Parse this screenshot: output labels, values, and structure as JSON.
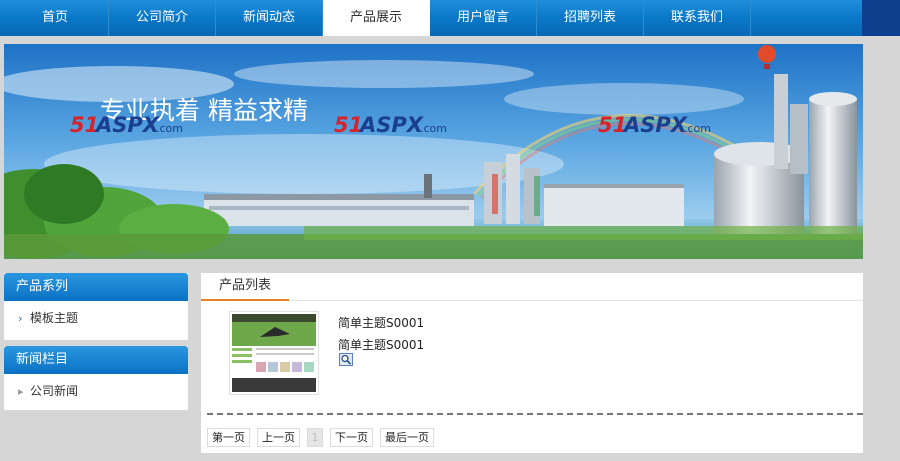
{
  "nav": {
    "items": [
      {
        "label": "首页"
      },
      {
        "label": "公司简介"
      },
      {
        "label": "新闻动态"
      },
      {
        "label": "产品展示"
      },
      {
        "label": "用户留言"
      },
      {
        "label": "招聘列表"
      },
      {
        "label": "联系我们"
      }
    ],
    "active_index": 3
  },
  "banner": {
    "slogan": "专业执着  精益求精",
    "logo_text": "51ASPX",
    "logo_suffix": ".com"
  },
  "sidebar": {
    "products": {
      "title": "产品系列",
      "items": [
        {
          "label": "模板主题"
        }
      ]
    },
    "news": {
      "title": "新闻栏目",
      "items": [
        {
          "label": "公司新闻"
        }
      ]
    }
  },
  "main": {
    "tab_label": "产品列表",
    "product": {
      "title1": "简单主题S0001",
      "title2": "简单主题S0001",
      "thumb_icon": "magnify-icon"
    },
    "pager": {
      "first": "第一页",
      "prev": "上一页",
      "current": "1",
      "next": "下一页",
      "last": "最后一页"
    }
  },
  "colors": {
    "nav_blue": "#0a78c8",
    "sidebar_head": "#0a72c4",
    "tab_accent": "#e67e22",
    "logo_red": "#d8232a",
    "logo_blue": "#1a3f8f"
  }
}
